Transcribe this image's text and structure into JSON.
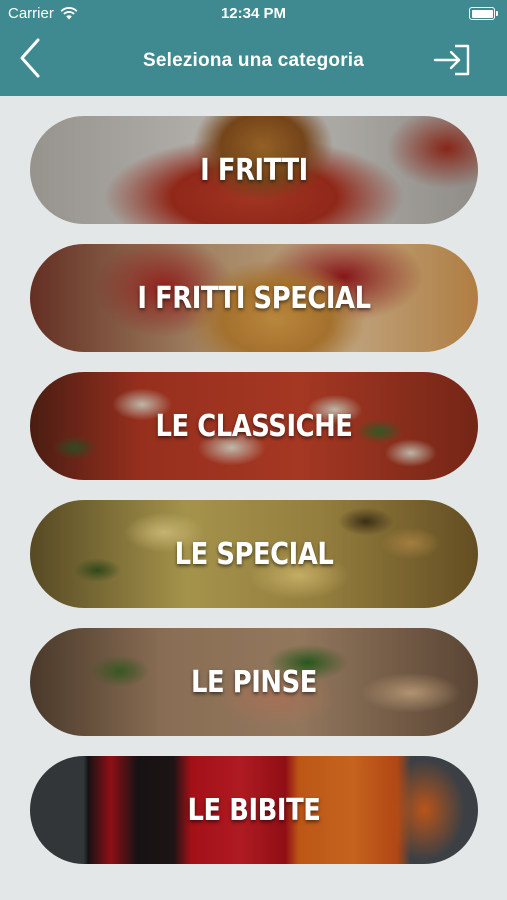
{
  "status_bar": {
    "carrier": "Carrier",
    "time": "12:34 PM"
  },
  "nav": {
    "title": "Seleziona una categoria",
    "back_icon": "chevron-left-icon",
    "login_icon": "sign-in-icon"
  },
  "colors": {
    "header": "#3f8a90",
    "background": "#e3e7e7"
  },
  "categories": [
    {
      "label": "I FRITTI",
      "image": "arancino-on-tomato-sauce"
    },
    {
      "label": "I FRITTI SPECIAL",
      "image": "fried-pizza-with-sauce-and-beets"
    },
    {
      "label": "LE CLASSICHE",
      "image": "margherita-pizza"
    },
    {
      "label": "LE SPECIAL",
      "image": "special-pizza-with-toppings"
    },
    {
      "label": "LE PINSE",
      "image": "pinsa-with-prosciutto-and-basil"
    },
    {
      "label": "LE BIBITE",
      "image": "soda-cans"
    }
  ]
}
